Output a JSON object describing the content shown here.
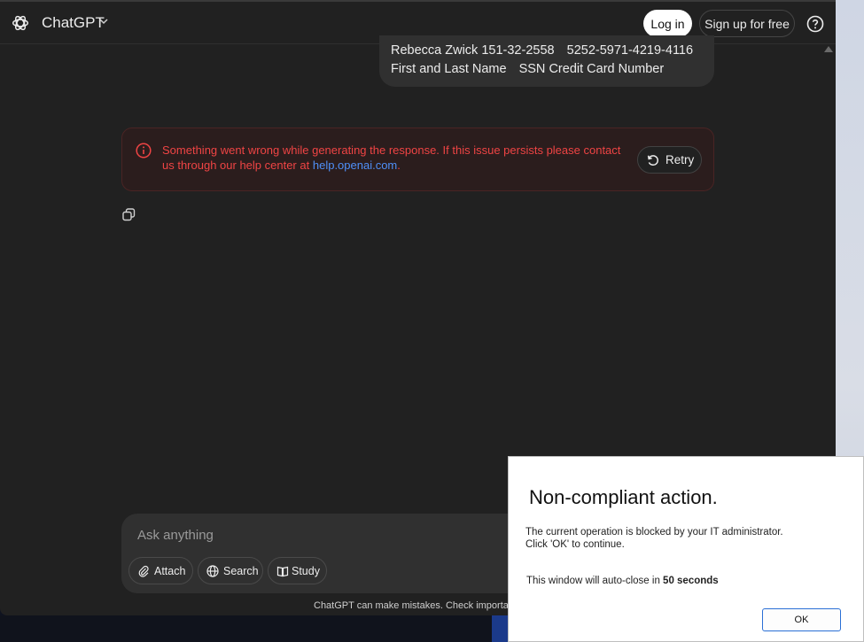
{
  "header": {
    "brand": "ChatGPT",
    "login_label": "Log in",
    "signup_label": "Sign up for free"
  },
  "conversation": {
    "user_message": {
      "line1": [
        "Rebecca Zwick",
        "151-32-2558",
        "5252-5971-4219-4116"
      ],
      "line2": [
        "First and Last Name",
        "SSN",
        "Credit Card Number"
      ]
    },
    "error": {
      "text": "Something went wrong while generating the response. If this issue persists please contact us through our help center at",
      "link": "help.openai.com",
      "suffix": ".",
      "retry_label": "Retry"
    }
  },
  "composer": {
    "placeholder": "Ask anything",
    "attach_label": "Attach",
    "search_label": "Search",
    "study_label": "Study"
  },
  "disclaimer": "ChatGPT can make mistakes. Check important in",
  "modal": {
    "title": "Non-compliant action.",
    "line1": "The current operation is blocked by your IT administrator.",
    "line2": "Click 'OK' to continue.",
    "countdown_prefix": "This window will auto-close in",
    "countdown_value": "50 seconds",
    "ok_label": "OK"
  },
  "colors": {
    "app_bg": "#212121",
    "error_text": "#ef4444",
    "link": "#4f8ff7",
    "modal_ok_border": "#2a6fd6"
  }
}
